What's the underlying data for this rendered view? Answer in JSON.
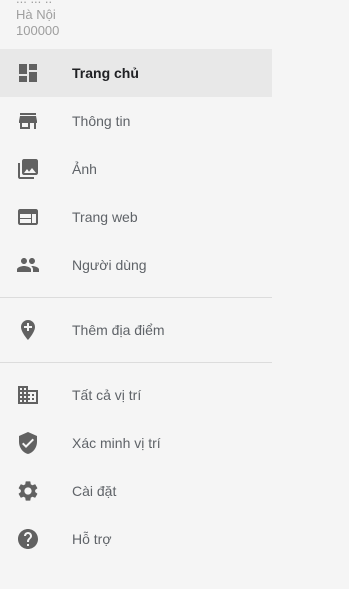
{
  "address": {
    "line1": "Hà Nội",
    "line2": "100000",
    "cut_line": "... ...  .."
  },
  "nav": {
    "main": [
      {
        "label": "Trang chủ",
        "icon": "dashboard-icon",
        "active": true
      },
      {
        "label": "Thông tin",
        "icon": "storefront-icon"
      },
      {
        "label": "Ảnh",
        "icon": "photo-library-icon"
      },
      {
        "label": "Trang web",
        "icon": "web-icon"
      },
      {
        "label": "Người dùng",
        "icon": "people-icon"
      }
    ],
    "add": [
      {
        "label": "Thêm địa điểm",
        "icon": "add-location-icon"
      }
    ],
    "more": [
      {
        "label": "Tất cả vị trí",
        "icon": "building-icon"
      },
      {
        "label": "Xác minh vị trí",
        "icon": "verified-shield-icon"
      },
      {
        "label": "Cài đặt",
        "icon": "gear-icon"
      },
      {
        "label": "Hỗ trợ",
        "icon": "help-icon"
      }
    ]
  },
  "colors": {
    "background": "#f5f5f5",
    "active_row": "#e8e8e8",
    "icon": "#616161",
    "divider": "#dcdcdc"
  }
}
